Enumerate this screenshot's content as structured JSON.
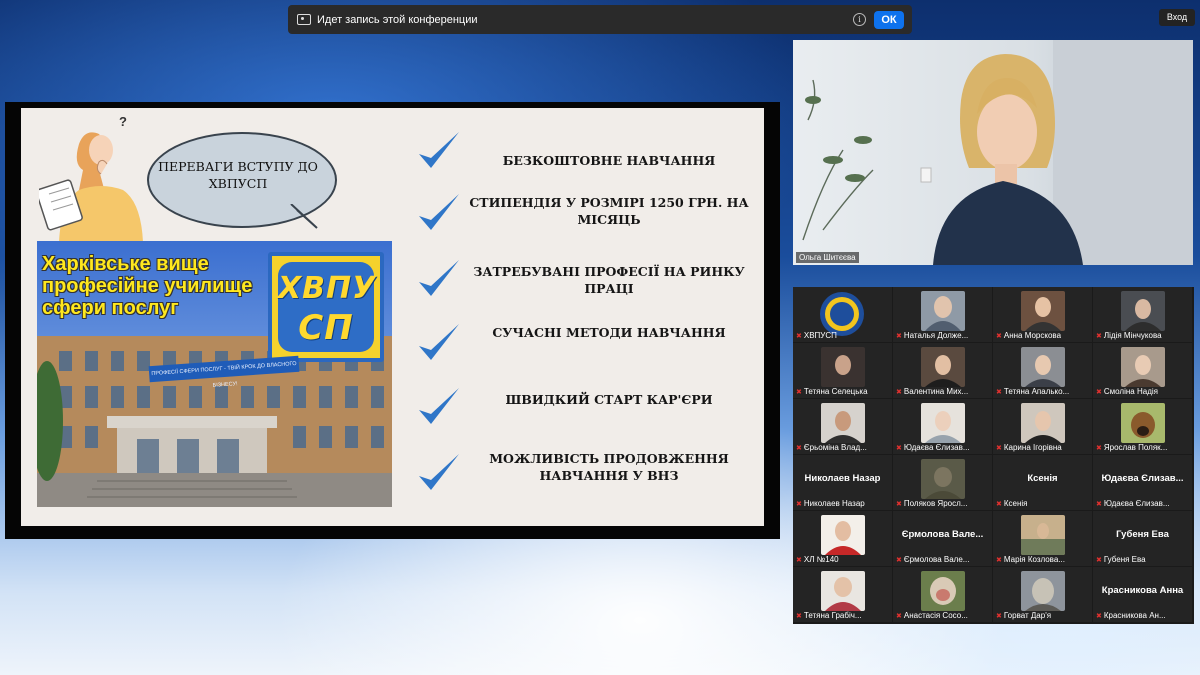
{
  "recording_bar": {
    "text": "Идет запись этой конференции",
    "ok_label": "ОК"
  },
  "login_label": "Вход",
  "slide": {
    "question_mark": "?",
    "bubble_text": "ПЕРЕВАГИ ВСТУПУ ДО ХВПУСП",
    "photo_title_lines": [
      "Харківське вище",
      "професійне училище",
      "сфери послуг"
    ],
    "logo_line1": "ХВПУ",
    "logo_line2": "СП",
    "banner_text": "ПРОФЕСІЇ СФЕРИ ПОСЛУГ - ТВІЙ КРОК ДО ВЛАСНОГО БІЗНЕСУ!",
    "items": [
      "БЕЗКОШТОВНЕ НАВЧАННЯ",
      "СТИПЕНДІЯ У РОЗМІРІ 1250 ГРН. НА МІСЯЦЬ",
      "ЗАТРЕБУВАНІ ПРОФЕСІЇ НА РИНКУ ПРАЦІ",
      "СУЧАСНІ МЕТОДИ НАВЧАННЯ",
      "ШВИДКИЙ СТАРТ КАР'ЄРИ",
      "МОЖЛИВІСТЬ ПРОДОВЖЕННЯ НАВЧАННЯ  У ВНЗ"
    ]
  },
  "speaker": {
    "name": "Ольга Шитєєва"
  },
  "gallery": [
    {
      "name": "ХВПУСП"
    },
    {
      "name": "Наталья Долже..."
    },
    {
      "name": "Анна Морскова"
    },
    {
      "name": "Лідія Мінчукова"
    },
    {
      "name": "Тетяна Селецька"
    },
    {
      "name": "Валентина Мих..."
    },
    {
      "name": "Тетяна Апалько..."
    },
    {
      "name": "Смоліна Надія"
    },
    {
      "name": "Єрьоміна Влад..."
    },
    {
      "name": "Юдаєва Єлизав..."
    },
    {
      "name": "Карина Ігорівна"
    },
    {
      "name": "Ярослав Поляк..."
    },
    {
      "name": "Николаев Назар",
      "big": "Николаев Назар"
    },
    {
      "name": "Поляков Яросл..."
    },
    {
      "name": "Ксенія",
      "big": "Ксенія"
    },
    {
      "name": "Юдаєва Єлизав...",
      "big": "Юдаєва Єлизав..."
    },
    {
      "name": "ХЛ №140"
    },
    {
      "name": "Єрмолова Вале...",
      "big": "Єрмолова  Вале..."
    },
    {
      "name": "Марія Козлова..."
    },
    {
      "name": "Губеня Ева",
      "big": "Губеня Ева"
    },
    {
      "name": "Тетяна Грабіч..."
    },
    {
      "name": "Анастасія Сосо..."
    },
    {
      "name": "Горват Дар'я"
    },
    {
      "name": "Красникова Ан...",
      "big": "Красникова Анна"
    }
  ],
  "colors": {
    "ok_button": "#0e72ed",
    "check": "#2f76c8",
    "logo_yellow": "#f5d22c",
    "logo_blue": "#2e6dc6",
    "photo_title": "#ffe81e",
    "muted_mic": "#e0312f"
  }
}
